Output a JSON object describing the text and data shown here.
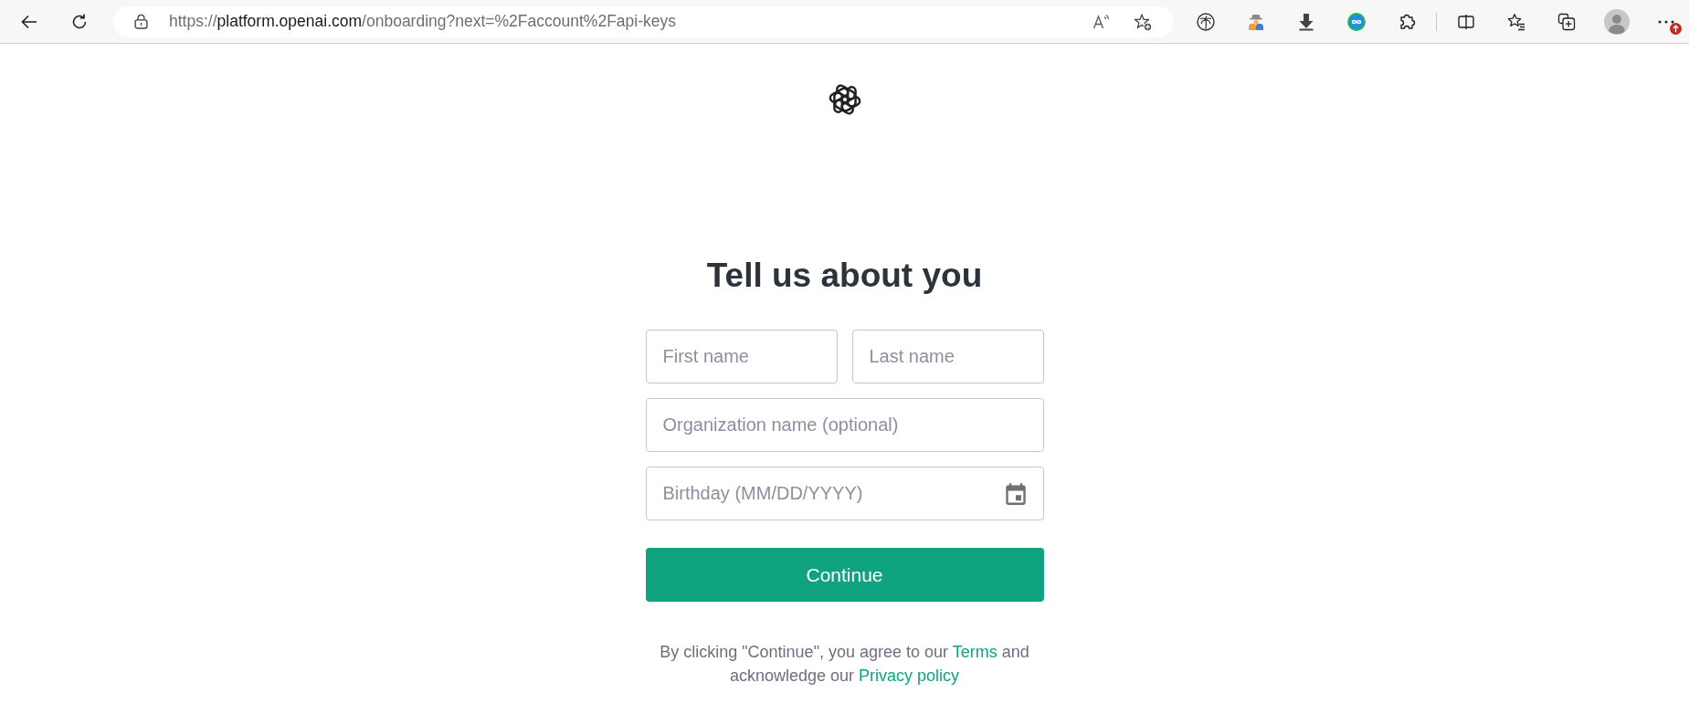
{
  "browser": {
    "url": {
      "scheme": "https://",
      "host": "platform.openai.com",
      "path": "/onboarding?next=%2Faccount%2Fapi-keys"
    }
  },
  "page": {
    "title": "Tell us about you",
    "field_rows": [
      [
        {
          "kind": "text",
          "placeholder": "First name"
        },
        {
          "kind": "text",
          "placeholder": "Last name"
        }
      ],
      [
        {
          "kind": "text",
          "placeholder": "Organization name (optional)"
        }
      ],
      [
        {
          "kind": "date",
          "placeholder": "Birthday (MM/DD/YYYY)"
        }
      ]
    ],
    "button": "Continue",
    "legal": [
      {
        "kind": "text",
        "text": "By clicking \"Continue\", you agree to our "
      },
      {
        "kind": "link",
        "text": "Terms"
      },
      {
        "kind": "text",
        "text": " and acknowledge our "
      },
      {
        "kind": "link",
        "text": "Privacy policy"
      }
    ]
  }
}
